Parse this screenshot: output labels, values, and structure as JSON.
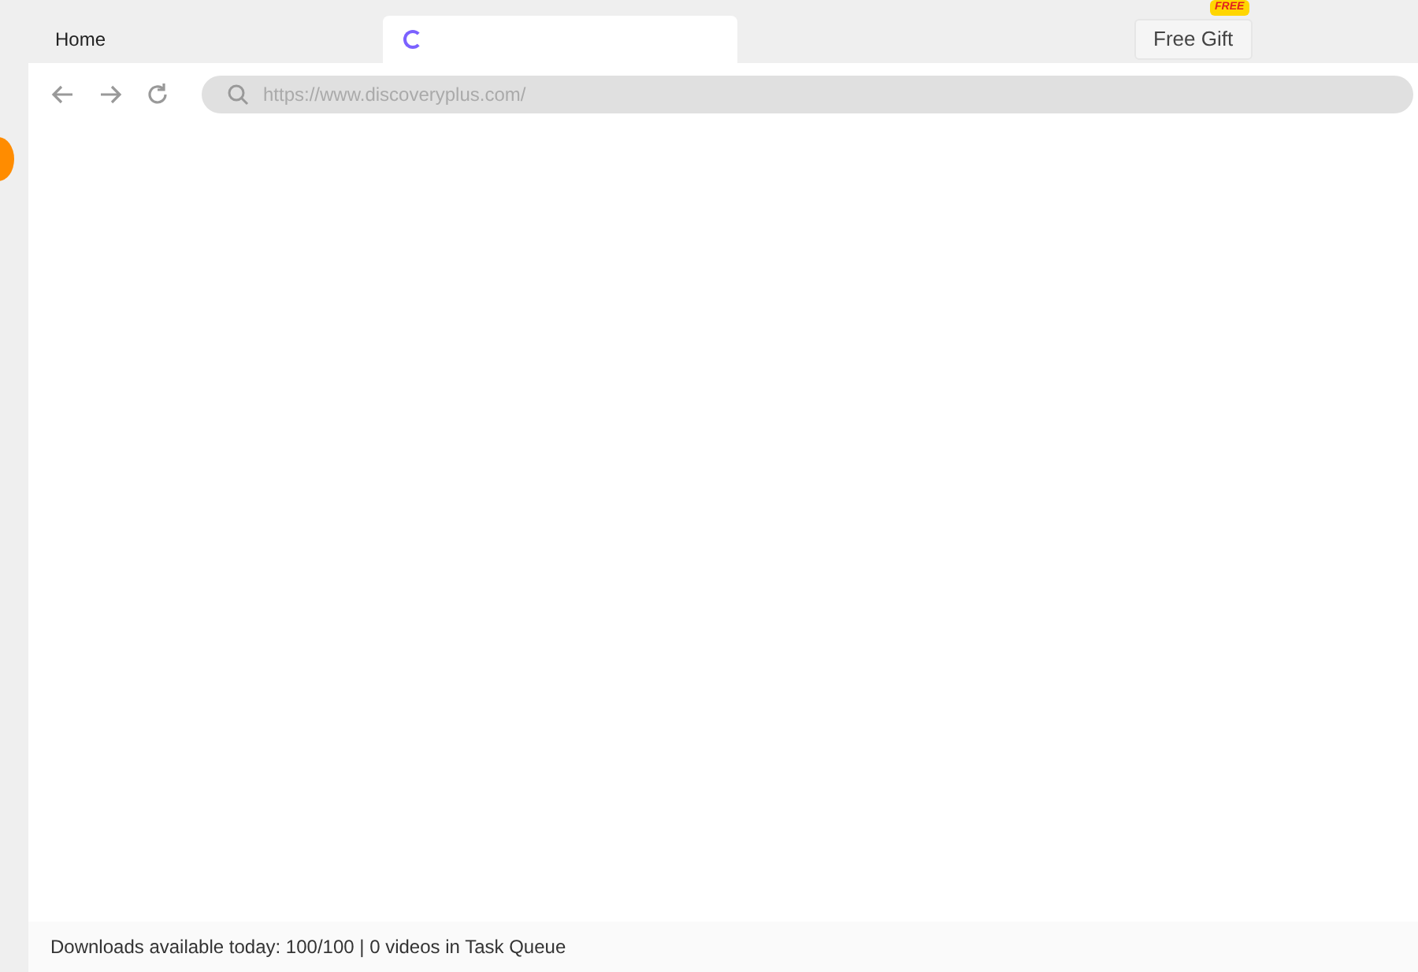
{
  "tabs": [
    {
      "label": "Home",
      "selected": false,
      "loading": false
    },
    {
      "selected": true,
      "loading": true
    }
  ],
  "gift": {
    "badge": "FREE",
    "label": "Free Gift"
  },
  "address_bar": {
    "url": "https://www.discoveryplus.com/"
  },
  "status_bar": "Downloads available today: 100/100 | 0 videos in Task Queue"
}
